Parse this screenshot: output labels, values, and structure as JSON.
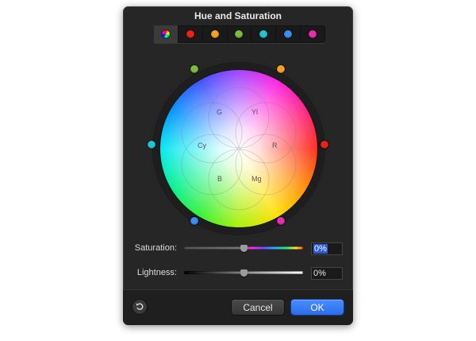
{
  "dialog": {
    "title": "Hue and Saturation"
  },
  "tabs": [
    {
      "name": "master",
      "color": "master",
      "selected": true
    },
    {
      "name": "red",
      "color": "#e8231b"
    },
    {
      "name": "yellow",
      "color": "#f5a31e"
    },
    {
      "name": "green",
      "color": "#7dbb3a"
    },
    {
      "name": "cyan",
      "color": "#22c4cf"
    },
    {
      "name": "blue",
      "color": "#3b8ff0"
    },
    {
      "name": "magenta",
      "color": "#e42fb0"
    }
  ],
  "wheel": {
    "labels": {
      "green": "G",
      "yellow": "Yl",
      "cyan": "Cy",
      "red": "R",
      "blue": "B",
      "magenta": "Mg"
    },
    "handles": {
      "green": "#7dbb3a",
      "yellow": "#f5a31e",
      "cyan": "#22c4cf",
      "red": "#e8231b",
      "blue": "#3b8ff0",
      "magenta": "#e42fb0"
    }
  },
  "saturation": {
    "label": "Saturation:",
    "value_selected": "0%",
    "level": 0.5
  },
  "lightness": {
    "label": "Lightness:",
    "value": "0%",
    "level": 0.5
  },
  "footer": {
    "cancel_label": "Cancel",
    "ok_label": "OK"
  }
}
